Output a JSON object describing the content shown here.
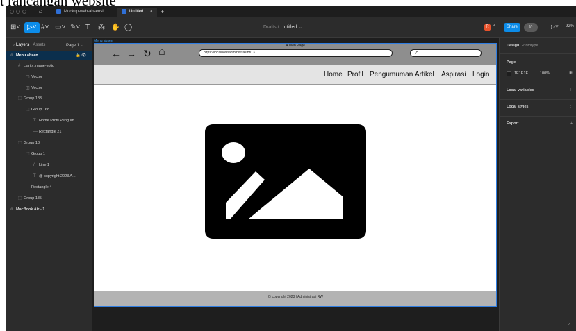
{
  "heading_fragment": "t rancangan website",
  "titlebar": {
    "tabs": [
      {
        "label": "Mockup-web-absensi"
      },
      {
        "label": "Untitled",
        "close": "×"
      }
    ],
    "add_tab": "+"
  },
  "toolbar": {
    "breadcrumb_parent": "Drafts",
    "breadcrumb_sep": " / ",
    "breadcrumb_file": "Untitled",
    "breadcrumb_chevron": "⌄",
    "avatar_initial": "R",
    "share_label": "Share",
    "library_label": "{/}",
    "zoom_label": "92%"
  },
  "left_panel": {
    "tab_layers": "Layers",
    "tab_assets": "Assets",
    "page_selector": "Page 1 ⌄",
    "layers": [
      {
        "label": "Menu absen",
        "icon": "frame-icon"
      },
      {
        "label": "clarity:image-solid",
        "icon": "frame-icon"
      },
      {
        "label": "Vector",
        "icon": "vector-icon"
      },
      {
        "label": "Vector",
        "icon": "vector-icon"
      },
      {
        "label": "Group 183",
        "icon": "group-icon"
      },
      {
        "label": "Group 168",
        "icon": "group-icon"
      },
      {
        "label": "Home Profil Pengum...",
        "icon": "text-icon"
      },
      {
        "label": "Rectangle 21",
        "icon": "rectangle-icon"
      },
      {
        "label": "Group 18",
        "icon": "group-icon"
      },
      {
        "label": "Group 1",
        "icon": "group-icon"
      },
      {
        "label": "Line 1",
        "icon": "line-icon"
      },
      {
        "label": "@ copyright 2023 A...",
        "icon": "text-icon"
      },
      {
        "label": "Rectangle 4",
        "icon": "rectangle-icon"
      },
      {
        "label": "Group 185",
        "icon": "group-icon"
      },
      {
        "label": "MacBook Air - 1",
        "icon": "frame-icon"
      }
    ]
  },
  "canvas": {
    "frame_label": "Menu absen",
    "browser_title": "A Web Page",
    "url": "https://localhost/administrasirw13",
    "nav_items": [
      "Home",
      "Profil",
      "Pengumuman",
      "Artikel",
      "Aspirasi",
      "Login"
    ],
    "footer": "@ copyright 2023 | Administrasi RW"
  },
  "right_panel": {
    "tab_design": "Design",
    "tab_prototype": "Prototype",
    "page_heading": "Page",
    "page_color": "1E1E1E",
    "page_opacity": "100%",
    "local_variables": "Local variables",
    "local_styles": "Local styles",
    "export": "Export"
  },
  "colors": {
    "accent": "#0c8ce9",
    "selection": "#2f7de1",
    "canvas_bg": "#1e1e1e",
    "panel_bg": "#2c2c2c",
    "avatar": "#e8522b"
  }
}
